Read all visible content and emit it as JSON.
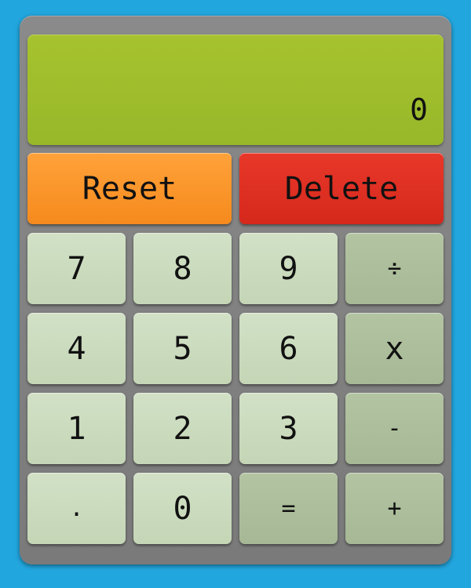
{
  "display": {
    "value": "0"
  },
  "controls": {
    "reset_label": "Reset",
    "delete_label": "Delete"
  },
  "keys": {
    "seven": "7",
    "eight": "8",
    "nine": "9",
    "divide": "÷",
    "four": "4",
    "five": "5",
    "six": "6",
    "multiply": "x",
    "one": "1",
    "two": "2",
    "three": "3",
    "minus": "-",
    "dot": ".",
    "zero": "0",
    "equals": "=",
    "plus": "+"
  },
  "colors": {
    "background": "#22a6de",
    "body": "#808080",
    "display": "#9fbd2c",
    "reset": "#f7931e",
    "delete": "#dc2f20",
    "number_key": "#ccdcbf",
    "operator_key": "#adbf9c"
  }
}
